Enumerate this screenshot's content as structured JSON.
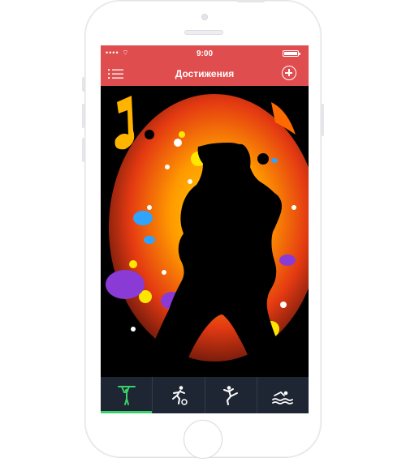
{
  "status": {
    "time": "9:00"
  },
  "header": {
    "title": "Достижения"
  },
  "artwork": {},
  "tabs": [
    {
      "icon": "pull-up-icon",
      "active": true
    },
    {
      "icon": "soccer-icon",
      "active": false
    },
    {
      "icon": "karate-icon",
      "active": false
    },
    {
      "icon": "swimming-icon",
      "active": false
    }
  ],
  "colors": {
    "header": "#df4d4f",
    "tabbar": "#1e2633",
    "active_indicator": "#3ad06b"
  }
}
